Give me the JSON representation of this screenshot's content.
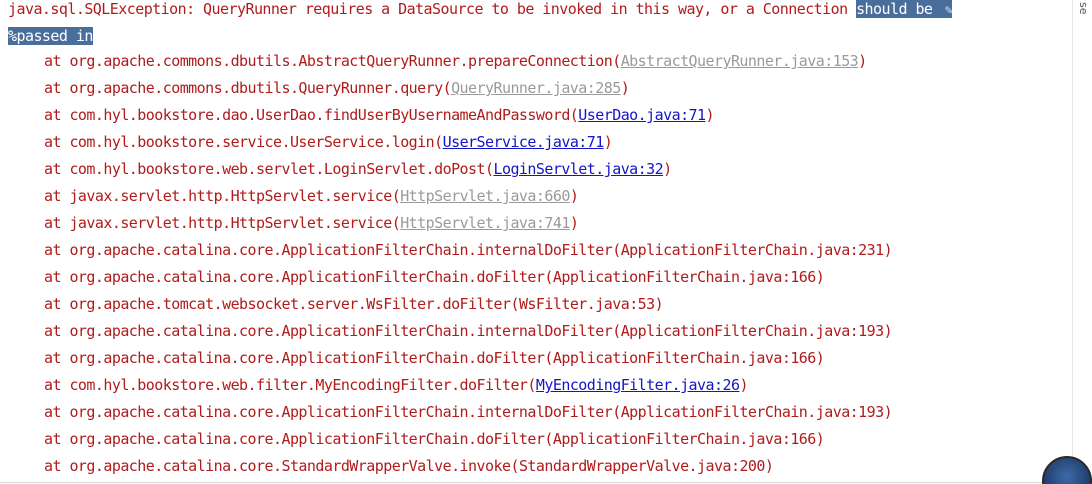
{
  "exception": {
    "prefix": "java.sql.SQLException: QueryRunner requires a DataSource to be invoked in this way, or a Connection ",
    "selected_1": "should be",
    "selected_2": "passed in",
    "percent": "%"
  },
  "frames": [
    {
      "at": "at org.apache.commons.dbutils.AbstractQueryRunner.prepareConnection(",
      "source": "AbstractQueryRunner.java:153",
      "link_style": "muted",
      "close": ")"
    },
    {
      "at": "at org.apache.commons.dbutils.QueryRunner.query(",
      "source": "QueryRunner.java:285",
      "link_style": "muted",
      "close": ")"
    },
    {
      "at": "at com.hyl.bookstore.dao.UserDao.findUserByUsernameAndPassword(",
      "source": "UserDao.java:71",
      "link_style": "link",
      "close": ")"
    },
    {
      "at": "at com.hyl.bookstore.service.UserService.login(",
      "source": "UserService.java:71",
      "link_style": "link",
      "close": ")"
    },
    {
      "at": "at com.hyl.bookstore.web.servlet.LoginServlet.doPost(",
      "source": "LoginServlet.java:32",
      "link_style": "link",
      "close": ")"
    },
    {
      "at": "at javax.servlet.http.HttpServlet.service(",
      "source": "HttpServlet.java:660",
      "link_style": "muted",
      "close": ")"
    },
    {
      "at": "at javax.servlet.http.HttpServlet.service(",
      "source": "HttpServlet.java:741",
      "link_style": "muted",
      "close": ")"
    },
    {
      "at": "at org.apache.catalina.core.ApplicationFilterChain.internalDoFilter(",
      "source": "ApplicationFilterChain.java:231",
      "link_style": "plain",
      "close": ")"
    },
    {
      "at": "at org.apache.catalina.core.ApplicationFilterChain.doFilter(",
      "source": "ApplicationFilterChain.java:166",
      "link_style": "plain",
      "close": ")"
    },
    {
      "at": "at org.apache.tomcat.websocket.server.WsFilter.doFilter(",
      "source": "WsFilter.java:53",
      "link_style": "plain",
      "close": ")"
    },
    {
      "at": "at org.apache.catalina.core.ApplicationFilterChain.internalDoFilter(",
      "source": "ApplicationFilterChain.java:193",
      "link_style": "plain",
      "close": ")"
    },
    {
      "at": "at org.apache.catalina.core.ApplicationFilterChain.doFilter(",
      "source": "ApplicationFilterChain.java:166",
      "link_style": "plain",
      "close": ")"
    },
    {
      "at": "at com.hyl.bookstore.web.filter.MyEncodingFilter.doFilter(",
      "source": "MyEncodingFilter.java:26",
      "link_style": "link",
      "close": ")"
    },
    {
      "at": "at org.apache.catalina.core.ApplicationFilterChain.internalDoFilter(",
      "source": "ApplicationFilterChain.java:193",
      "link_style": "plain",
      "close": ")"
    },
    {
      "at": "at org.apache.catalina.core.ApplicationFilterChain.doFilter(",
      "source": "ApplicationFilterChain.java:166",
      "link_style": "plain",
      "close": ")"
    },
    {
      "at": "at org.apache.catalina.core.StandardWrapperValve.invoke(",
      "source": "StandardWrapperValve.java:200",
      "link_style": "plain",
      "close": ")"
    }
  ],
  "side_label": "se",
  "icons": {
    "edit": "pencil-icon",
    "avatar": "user-avatar"
  },
  "colors": {
    "error_text": "#b01b1b",
    "link": "#1414c8",
    "muted_link": "#9a9a9a",
    "selection": "#4a6e9c"
  }
}
